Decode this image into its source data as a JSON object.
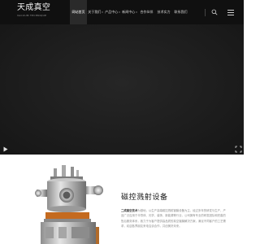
{
  "header": {
    "logo_cn": "天成真空",
    "logo_en": "VACUUM TECHNIQUE",
    "nav": [
      {
        "label": "网站首页",
        "active": true,
        "caret": ""
      },
      {
        "label": "关于我们",
        "active": false,
        "caret": "▾"
      },
      {
        "label": "产品中心",
        "active": false,
        "caret": "▾"
      },
      {
        "label": "新闻中心",
        "active": false,
        "caret": "▾"
      },
      {
        "label": "合作伙伴",
        "active": false,
        "caret": ""
      },
      {
        "label": "技术实力",
        "active": false,
        "caret": ""
      },
      {
        "label": "联系我们",
        "active": false,
        "caret": ""
      }
    ],
    "search_icon": "search-icon",
    "menu_icon": "hamburger-menu-icon"
  },
  "hero": {
    "play_icon": "play-icon",
    "fullscreen_icon": "fullscreen-icon"
  },
  "product": {
    "title": "磁控溅射设备",
    "desc_brand": "二成真空技术",
    "desc_text": "为基地，以生产高端磁控溅射镀膜设备为主，经过多年的研发与生产，产品广泛应用于半导体、光学、装饰、新能源等行业，公司拥有专业的研发团队和完善的售后服务体系，致力于为客户提供高品质的真空镀膜解决方案，满足不同客户的工艺需求，欢迎各界朋友来电洽谈合作，共创美好未来。"
  },
  "colors": {
    "header_bg": "#101010",
    "hero_bg": "#1e1e1e",
    "page_bg": "#ffffff"
  }
}
